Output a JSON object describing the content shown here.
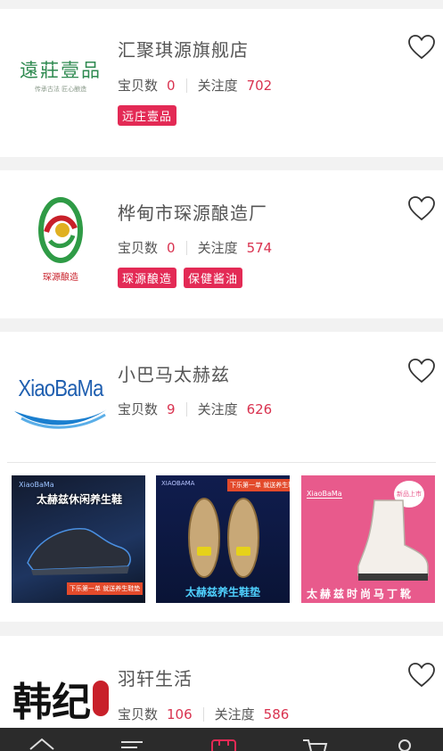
{
  "shops": [
    {
      "name": "汇聚琪源旗舰店",
      "items_label": "宝贝数",
      "items": "0",
      "follow_label": "关注度",
      "follow": "702",
      "tags": [
        "远庄壹品"
      ],
      "logo_text": "遠莊壹品",
      "logo_subtext": "传承古法 匠心酿造"
    },
    {
      "name": "桦甸市琛源酿造厂",
      "items_label": "宝贝数",
      "items": "0",
      "follow_label": "关注度",
      "follow": "574",
      "tags": [
        "琛源酿造",
        "保健酱油"
      ],
      "logo_text": "琛源酿造"
    },
    {
      "name": "小巴马太赫兹",
      "items_label": "宝贝数",
      "items": "9",
      "follow_label": "关注度",
      "follow": "626",
      "logo_text": "XiaoBaMa",
      "products": [
        {
          "brand": "XiaoBaMa",
          "headline": "太赫兹休闲养生鞋",
          "badge": "下乐第一单 就送养生鞋垫"
        },
        {
          "brand": "XIAOBAMA",
          "headline": "太赫兹养生鞋垫",
          "badge": "下乐第一单 就送养生鞋垫"
        },
        {
          "brand": "XiaoBaMa",
          "headline": "太赫兹时尚马丁靴",
          "badge": "新品上市"
        }
      ]
    },
    {
      "name": "羽轩生活",
      "items_label": "宝贝数",
      "items": "106",
      "follow_label": "关注度",
      "follow": "586",
      "logo_text": "韩纪"
    }
  ],
  "colors": {
    "accent": "#e32a55",
    "number": "#d9324f"
  }
}
